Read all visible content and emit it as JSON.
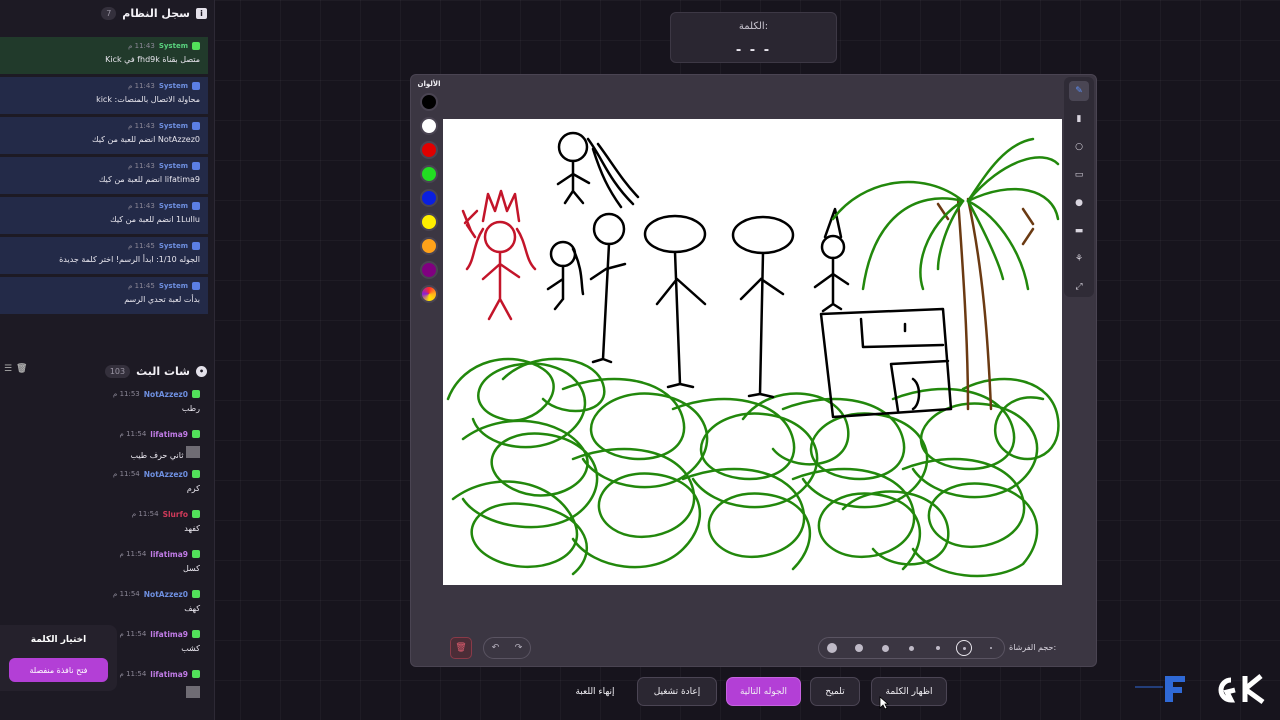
{
  "system_log": {
    "title": "سجل النظام",
    "count": "7",
    "entries": [
      {
        "author": "System",
        "time": "11:43 م",
        "text": "متصل بقناة fhd9k في Kick"
      },
      {
        "author": "System",
        "time": "11:43 م",
        "text": "محاولة الاتصال بالمنصات: kick"
      },
      {
        "author": "System",
        "time": "11:43 م",
        "text": "NotAzzez0 انضم للعبة من كيك"
      },
      {
        "author": "System",
        "time": "11:43 م",
        "text": "lifatima9 انضم للعبة من كيك"
      },
      {
        "author": "System",
        "time": "11:43 م",
        "text": "1Lullu انضم للعبة من كيك"
      },
      {
        "author": "System",
        "time": "11:45 م",
        "text": "الجوله 1/10: ابدأ الرسم! اختر كلمة جديدة"
      },
      {
        "author": "System",
        "time": "11:45 م",
        "text": "بدأت لعبة تحدي الرسم"
      }
    ]
  },
  "stream_chat": {
    "title": "شات البث",
    "count": "103",
    "messages": [
      {
        "author": "NotAzzez0",
        "author_color": "#6e8fe0",
        "time": "11:53 م",
        "text": "رطب",
        "sticker": false
      },
      {
        "author": "lifatima9",
        "author_color": "#c07be6",
        "time": "11:54 م",
        "text": "ثاني حرف طيب",
        "sticker": true
      },
      {
        "author": "NotAzzez0",
        "author_color": "#6e8fe0",
        "time": "11:54 م",
        "text": "كرم",
        "sticker": false
      },
      {
        "author": "Slurfo",
        "author_color": "#d23a5a",
        "time": "11:54 م",
        "text": "كفهد",
        "sticker": false
      },
      {
        "author": "lifatima9",
        "author_color": "#c07be6",
        "time": "11:54 م",
        "text": "كسل",
        "sticker": false
      },
      {
        "author": "NotAzzez0",
        "author_color": "#6e8fe0",
        "time": "11:54 م",
        "text": "كهف",
        "sticker": false
      },
      {
        "author": "lifatima9",
        "author_color": "#c07be6",
        "time": "11:54 م",
        "text": "كشب",
        "sticker": false
      },
      {
        "author": "lifatima9",
        "author_color": "#c07be6",
        "time": "11:54 م",
        "text": "",
        "sticker": true
      }
    ]
  },
  "word_choice": {
    "title": "اختيار الكلمة",
    "open_window_label": "فتح نافذة منفصلة"
  },
  "word_box": {
    "label": "الكلمة:",
    "value": "- - -"
  },
  "palette": {
    "label": "الألوان",
    "colors": [
      "#000000",
      "#ffffff",
      "#e00000",
      "#22dd22",
      "#0a1fe0",
      "#ffee00",
      "#ffa21a",
      "#800080"
    ]
  },
  "tools": [
    "pencil-icon",
    "eraser-icon",
    "circle-icon",
    "rectangle-icon",
    "fill-dot-icon",
    "stamp-icon",
    "bucket-icon",
    "line-icon"
  ],
  "brush_label": "حجم الفرشاة:",
  "buttons": {
    "reveal": "اظهار الكلمة",
    "hint": "تلميح",
    "next_round": "الجوله التالية",
    "restart": "إعادة تشغيل",
    "end_game": "إنهاء اللعبة"
  },
  "colors": {
    "accent": "#b33fd6",
    "drawing_green": "#22880c",
    "drawing_red": "#c3152a",
    "drawing_brown": "#6b3a12"
  }
}
